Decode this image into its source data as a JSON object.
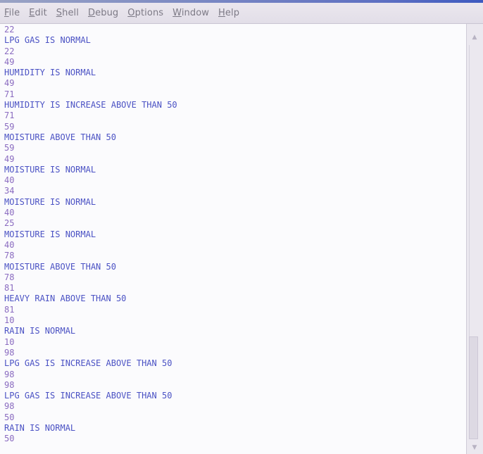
{
  "menubar": {
    "items": [
      {
        "label": "File",
        "mnemonic": "F"
      },
      {
        "label": "Edit",
        "mnemonic": "E"
      },
      {
        "label": "Shell",
        "mnemonic": "S"
      },
      {
        "label": "Debug",
        "mnemonic": "D"
      },
      {
        "label": "Options",
        "mnemonic": "O"
      },
      {
        "label": "Window",
        "mnemonic": "W"
      },
      {
        "label": "Help",
        "mnemonic": "H"
      }
    ]
  },
  "shell_output": {
    "lines": [
      "22",
      "LPG GAS IS NORMAL",
      "22",
      "49",
      "HUMIDITY IS NORMAL",
      "49",
      "71",
      "HUMIDITY IS INCREASE ABOVE THAN 50",
      "71",
      "59",
      "MOISTURE ABOVE THAN 50",
      "59",
      "49",
      "MOISTURE IS NORMAL",
      "40",
      "34",
      "MOISTURE IS NORMAL",
      "40",
      "25",
      "MOISTURE IS NORMAL",
      "40",
      "78",
      "MOISTURE ABOVE THAN 50",
      "78",
      "81",
      "HEAVY RAIN ABOVE THAN 50",
      "81",
      "10",
      "RAIN IS NORMAL",
      "10",
      "98",
      "LPG GAS IS INCREASE ABOVE THAN 50",
      "98",
      "98",
      "LPG GAS IS INCREASE ABOVE THAN 50",
      "98",
      "50",
      "RAIN IS NORMAL",
      "50"
    ]
  },
  "scrollbar": {
    "position_fraction": 0.79,
    "up_arrow_icon": "triangle-up-icon",
    "down_arrow_icon": "triangle-down-icon"
  },
  "colors": {
    "text_message": "#4b52c4",
    "text_number": "#8a6bc0",
    "menu_text": "#7d7a86",
    "background": "#fbfbfd"
  }
}
